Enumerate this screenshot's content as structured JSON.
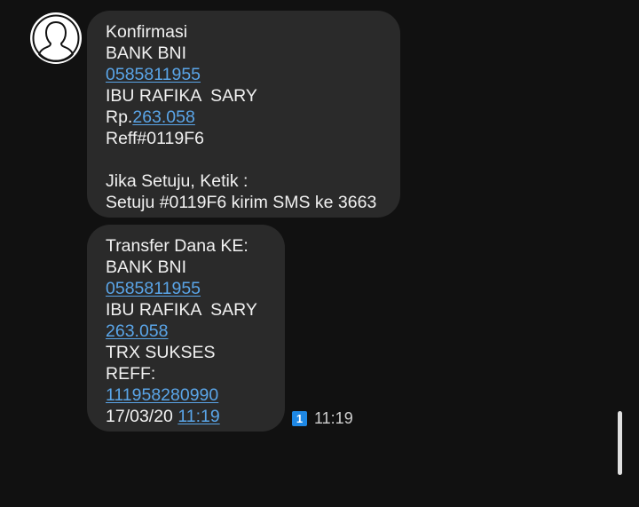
{
  "sender": {
    "avatar_icon": "contact-avatar-icon"
  },
  "messages": [
    {
      "lines": [
        [
          {
            "text": "Konfirmasi"
          }
        ],
        [
          {
            "text": "BANK BNI"
          }
        ],
        [
          {
            "text": "0585811955",
            "link": true
          }
        ],
        [
          {
            "text": "IBU RAFIKA  SARY"
          }
        ],
        [
          {
            "text": "Rp."
          },
          {
            "text": "263.058",
            "link": true
          }
        ],
        [
          {
            "text": "Reff#0119F6"
          }
        ],
        [
          {
            "text": ""
          }
        ],
        [
          {
            "text": "Jika Setuju, Ketik :"
          }
        ],
        [
          {
            "text": "Setuju #0119F6 kirim SMS ke 3663"
          }
        ]
      ]
    },
    {
      "lines": [
        [
          {
            "text": "Transfer Dana KE:"
          }
        ],
        [
          {
            "text": "BANK BNI"
          }
        ],
        [
          {
            "text": "0585811955",
            "link": true
          }
        ],
        [
          {
            "text": "IBU RAFIKA  SARY"
          }
        ],
        [
          {
            "text": "263.058",
            "link": true
          }
        ],
        [
          {
            "text": "TRX SUKSES"
          }
        ],
        [
          {
            "text": "REFF:"
          }
        ],
        [
          {
            "text": "111958280990",
            "link": true
          }
        ],
        [
          {
            "text": "17/03/20 "
          },
          {
            "text": "11:19",
            "link": true
          }
        ]
      ]
    }
  ],
  "message_meta": {
    "sim_slot": "1",
    "time": "11:19",
    "sim_icon": "sim-1-icon"
  },
  "colors": {
    "background": "#111111",
    "bubble": "#2a2a2a",
    "link": "#5aa5e8",
    "sim_badge": "#1e88e5"
  }
}
